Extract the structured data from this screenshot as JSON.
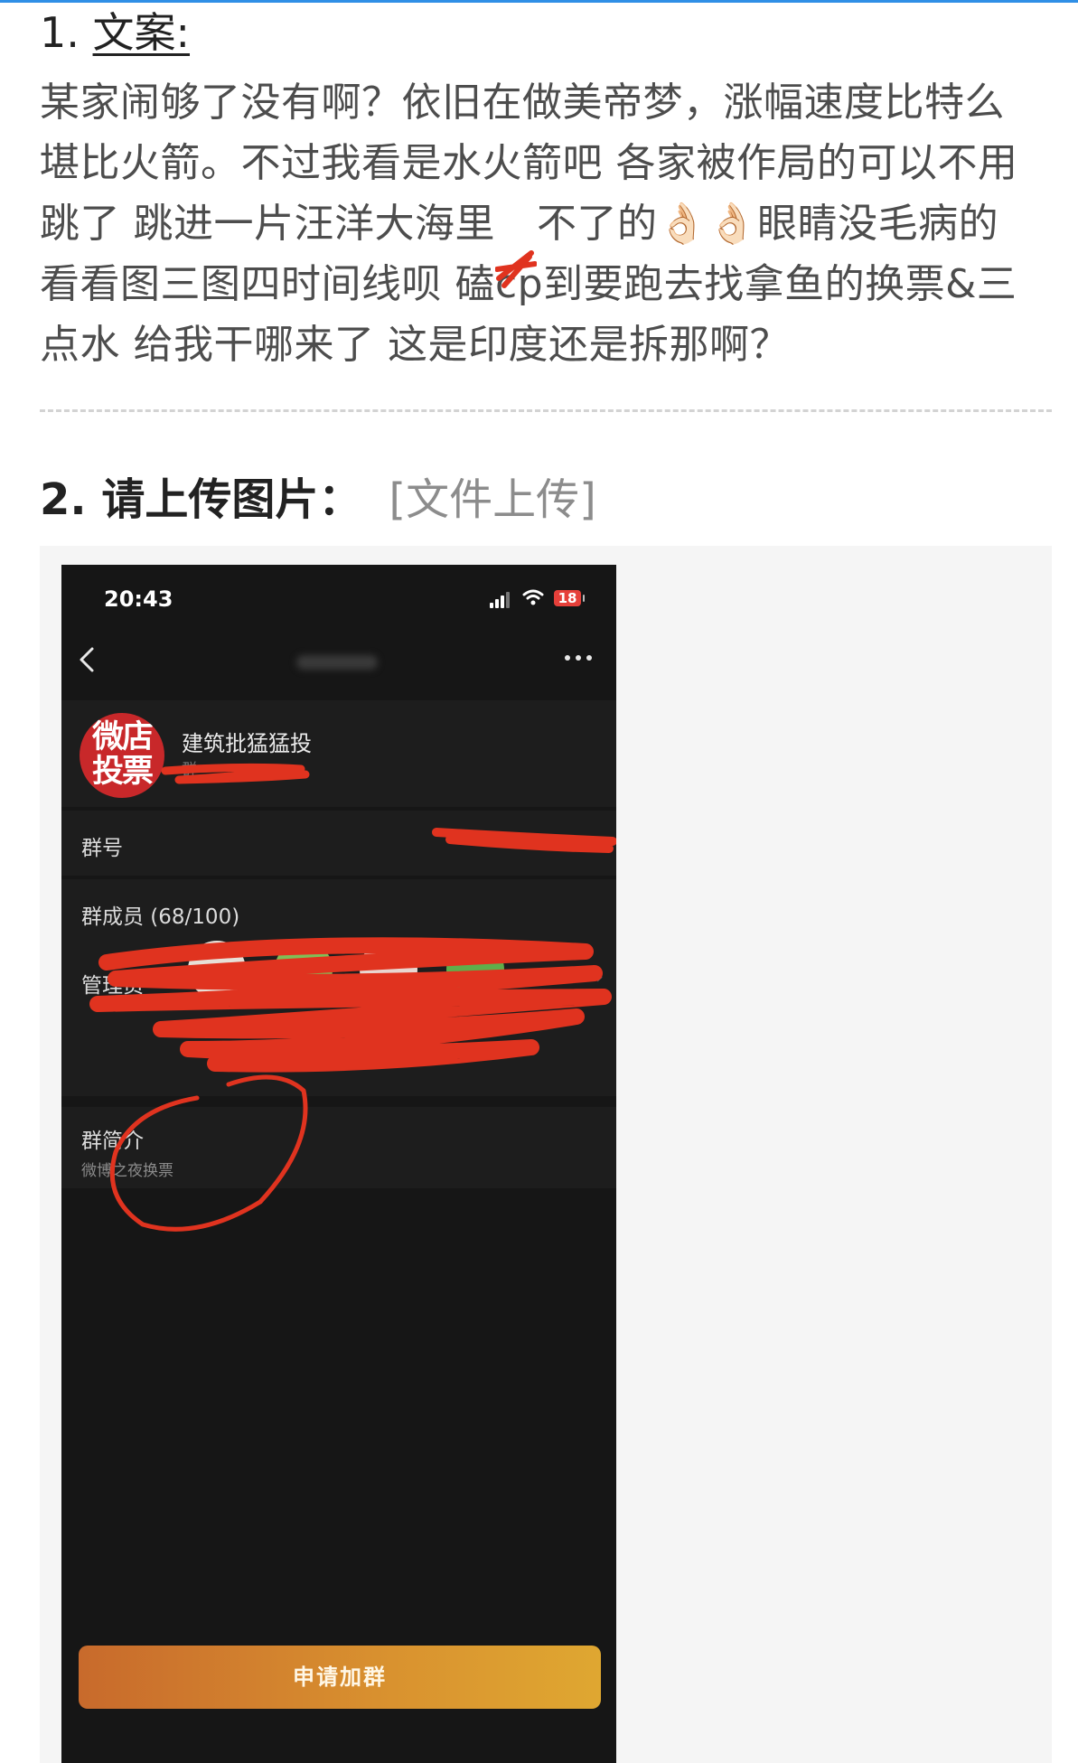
{
  "question1": {
    "number": "1.",
    "label": "文案:",
    "answer_lines": [
      "某家闹够了没有啊？依旧在做美帝梦，涨幅速度比特么",
      "堪比火箭。不过我看是水火箭吧 各家被作局的可以不用",
      "跳了 跳进一片汪洋大海里",
      "不了的",
      "👌🏻👌🏻",
      "眼睛没毛病的",
      "看看图三图四时间线呗 磕cp到要跑去找拿鱼的换票&三",
      "点水 给我干哪来了 这是印度还是拆那啊？"
    ]
  },
  "question2": {
    "title": "2. 请上传图片：",
    "upload_label": "[文件上传]"
  },
  "phone": {
    "status_time": "20:43",
    "battery": "18",
    "group_name": "建筑批猛猛投",
    "group_sub": "群",
    "avatar_text": [
      "微店",
      "投票"
    ],
    "rows": {
      "group_id_label": "群号",
      "members_label": "群成员 (68/100)",
      "admins_label": "管理员",
      "intro_label": "群简介",
      "intro_value": "微博之夜换票"
    },
    "apply_button": "申请加群"
  },
  "colors": {
    "accent_line": "#2f8fe6",
    "scribble_red": "#e0331f",
    "button_orange": "#d9922f"
  }
}
